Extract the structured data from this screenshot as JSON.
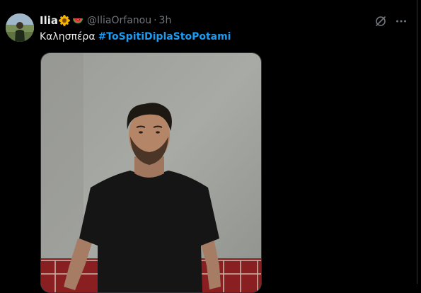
{
  "tweet": {
    "display_name": "Ilia",
    "handle": "@IliaOrfanou",
    "separator": "·",
    "time": "3h",
    "text": "Καλησπέρα",
    "hashtag": "#ToSpitiDiplaStoPotami",
    "name_emojis": [
      "sunflower-emoji",
      "watermelon-emoji"
    ]
  },
  "actions": {
    "grok_icon": "grok-icon",
    "more_icon": "more-icon"
  },
  "media": {
    "kind": "photo"
  },
  "colors": {
    "background": "#000000",
    "primary_text": "#e7e9ea",
    "secondary_text": "#71767b",
    "hashtag": "#1d9bf0",
    "border": "#2f3336"
  }
}
